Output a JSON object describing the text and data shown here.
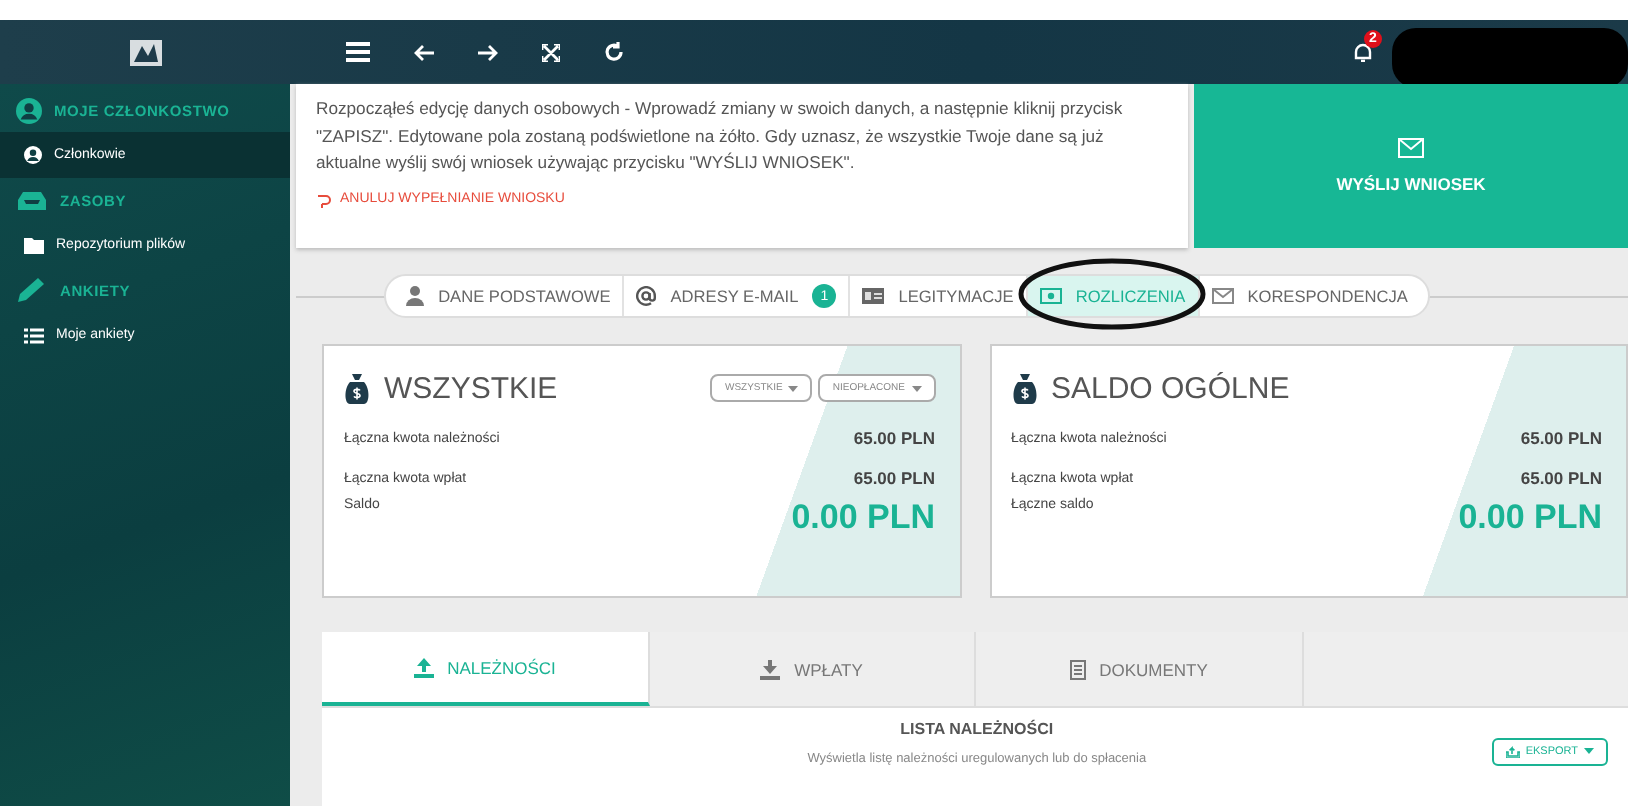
{
  "header": {
    "notifications": "2"
  },
  "sidebar": {
    "items": [
      {
        "kind": "section",
        "label": "MOJE CZŁONKOSTWO",
        "selected": false
      },
      {
        "kind": "item",
        "label": "Członkowie",
        "selected": true
      },
      {
        "kind": "section",
        "label": "ZASOBY",
        "selected": false
      },
      {
        "kind": "item",
        "label": "Repozytorium plików",
        "selected": false
      },
      {
        "kind": "section",
        "label": "ANKIETY",
        "selected": false
      },
      {
        "kind": "item",
        "label": "Moje ankiety",
        "selected": false
      }
    ]
  },
  "notice": {
    "text": "Rozpocząłeś edycję danych osobowych - Wprowadź zmiany w swoich danych, a następnie kliknij przycisk \"ZAPISZ\". Edytowane pola zostaną podświetlone na żółto. Gdy uznasz, że wszystkie Twoje dane są już aktualne wyślij swój wniosek używając przycisku \"WYŚLIJ WNIOSEK\".",
    "cancel": "ANULUJ WYPEŁNIANIE WNIOSKU",
    "send": "WYŚLIJ WNIOSEK"
  },
  "tabs": [
    {
      "label": "DANE PODSTAWOWE",
      "selected": false
    },
    {
      "label": "ADRESY E-MAIL",
      "badge": "1",
      "selected": false
    },
    {
      "label": "LEGITYMACJE",
      "selected": false
    },
    {
      "label": "ROZLICZENIA",
      "selected": true
    },
    {
      "label": "KORESPONDENCJA",
      "selected": false
    }
  ],
  "cards": [
    {
      "title": "WSZYSTKIE",
      "filters": [
        "WSZYSTKIE",
        "NIEOPŁACONE"
      ],
      "rows": [
        {
          "label": "Łączna kwota należności",
          "value": "65.00 PLN"
        },
        {
          "label": "Łączna kwota wpłat",
          "value": "65.00 PLN"
        }
      ],
      "total_label": "Saldo",
      "total": "0.00 PLN"
    },
    {
      "title": "SALDO OGÓLNE",
      "rows": [
        {
          "label": "Łączna kwota należności",
          "value": "65.00 PLN"
        },
        {
          "label": "Łączna kwota wpłat",
          "value": "65.00 PLN"
        }
      ],
      "total_label": "Łączne saldo",
      "total": "0.00 PLN"
    }
  ],
  "subtabs": [
    {
      "label": "NALEŻNOŚCI",
      "selected": true
    },
    {
      "label": "WPŁATY",
      "selected": false
    },
    {
      "label": "DOKUMENTY",
      "selected": false
    }
  ],
  "list": {
    "title": "LISTA NALEŻNOŚCI",
    "subtitle": "Wyświetla listę należności uregulowanych lub do spłacenia",
    "export": "EKSPORT"
  }
}
